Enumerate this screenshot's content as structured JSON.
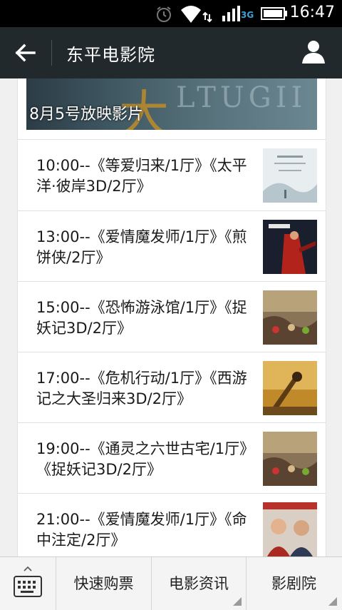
{
  "status_bar": {
    "time": "16:47",
    "network": "3G"
  },
  "header": {
    "title": "东平电影院"
  },
  "banner": {
    "label": "8月5号放映影片"
  },
  "showtimes": [
    {
      "text": "10:00--《等爱归来/1厅》《太平洋·彼岸3D/2厅》"
    },
    {
      "text": "13:00--《爱情魔发师/1厅》《煎饼侠/2厅》"
    },
    {
      "text": "15:00--《恐怖游泳馆/1厅》《捉妖记3D/2厅》"
    },
    {
      "text": "17:00--《危机行动/1厅》《西游记之大圣归来3D/2厅》"
    },
    {
      "text": "19:00--《通灵之六世古宅/1厅》《捉妖记3D/2厅》"
    },
    {
      "text": "21:00--《爱情魔发师/1厅》《命中注定/2厅》"
    }
  ],
  "bottom_nav": {
    "tabs": [
      {
        "label": "快速购票"
      },
      {
        "label": "电影资讯"
      },
      {
        "label": "影剧院"
      }
    ]
  },
  "icons": {
    "back": "back-arrow-icon",
    "user": "user-icon",
    "keyboard": "keyboard-icon",
    "alarm": "alarm-icon",
    "wifi": "wifi-icon",
    "signal": "signal-icon",
    "battery": "battery-icon"
  }
}
